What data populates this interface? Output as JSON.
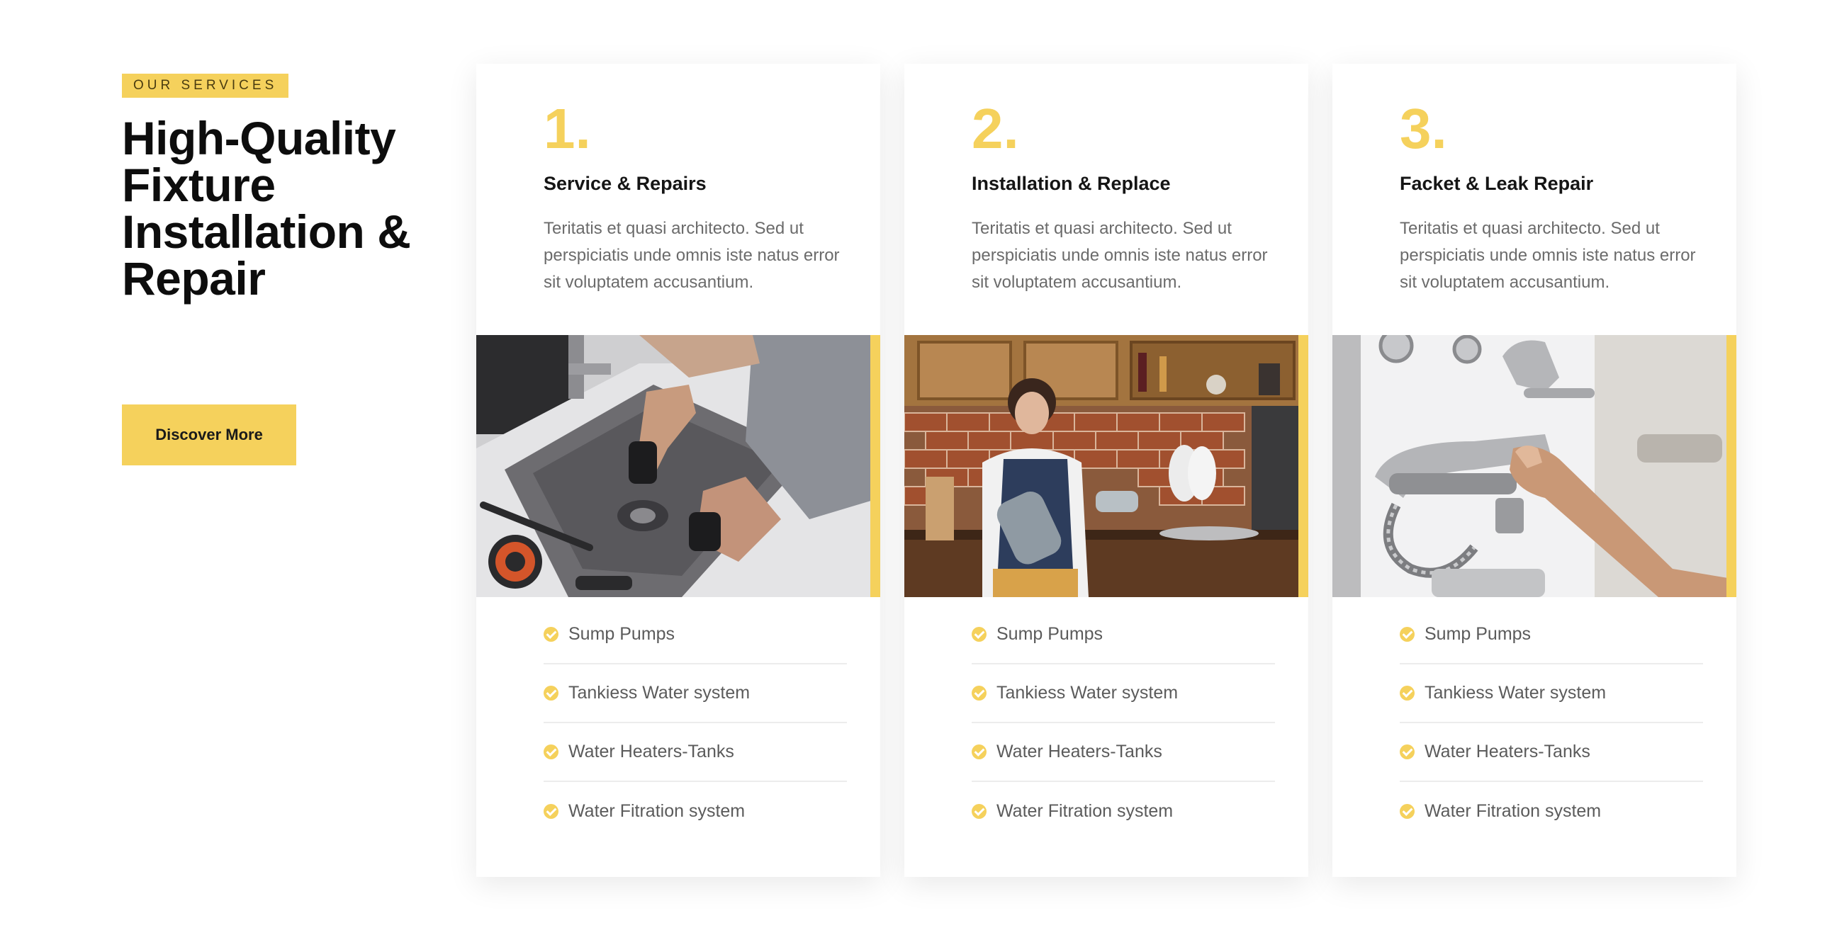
{
  "intro": {
    "eyebrow": "OUR SERVICES",
    "headline": "High-Quality\nFixture\nInstallation &\nRepair",
    "button_label": "Discover More"
  },
  "colors": {
    "accent": "#f5d15c",
    "heading": "#0d0d0d",
    "body_text": "#6b6b6b"
  },
  "cards": [
    {
      "number": "1.",
      "title": "Service & Repairs",
      "description": "Teritatis et quasi architecto. Sed ut perspiciatis unde omnis iste natus error sit voluptatem accusantium.",
      "image": "plumber-fixing-sink-photo",
      "features": [
        "Sump Pumps",
        "Tankiess Water system",
        "Water Heaters-Tanks",
        "Water Fitration system"
      ]
    },
    {
      "number": "2.",
      "title": "Installation & Replace",
      "description": "Teritatis et quasi architecto. Sed ut perspiciatis unde omnis iste natus error sit voluptatem accusantium.",
      "image": "woman-in-kitchen-with-pipe-photo",
      "features": [
        "Sump Pumps",
        "Tankiess Water system",
        "Water Heaters-Tanks",
        "Water Fitration system"
      ]
    },
    {
      "number": "3.",
      "title": "Facket & Leak Repair",
      "description": "Teritatis et quasi architecto. Sed ut perspiciatis unde omnis iste natus error sit voluptatem accusantium.",
      "image": "faucet-showroom-photo",
      "features": [
        "Sump Pumps",
        "Tankiess Water system",
        "Water Heaters-Tanks",
        "Water Fitration system"
      ]
    }
  ]
}
